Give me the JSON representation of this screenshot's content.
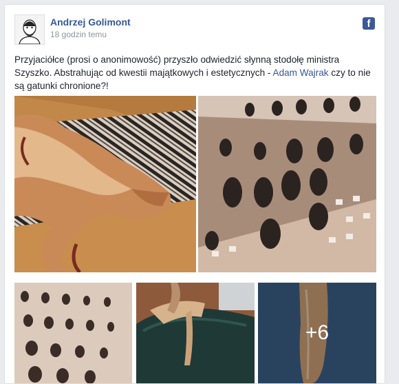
{
  "post": {
    "author": "Andrzej Golimont",
    "timestamp": "18 godzin temu",
    "platform_icon": "facebook-icon",
    "text_before_link": "Przyjaciółce (prosi o anonimowość) przyszło odwiedzić słynną stodołę ministra Szyszko. Abstrahując od kwestii majątkowych i estetycznych - ",
    "mention": "Adam Wajrak",
    "text_after_link": " czy to nie są gatunki chronione?!"
  },
  "photos": {
    "more_count_label": "+6"
  },
  "colors": {
    "link": "#365899",
    "facebook_blue": "#3b5998",
    "meta_gray": "#90949c",
    "text": "#1d2129"
  }
}
